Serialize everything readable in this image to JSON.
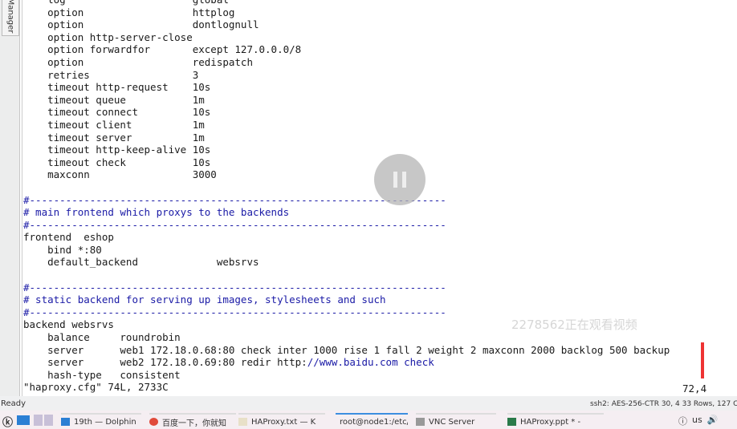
{
  "side_panel": {
    "label": "Manager"
  },
  "editor": {
    "lines": [
      [
        {
          "t": "    log                     global",
          "c": "n"
        }
      ],
      [
        {
          "t": "    option                  httplog",
          "c": "n"
        }
      ],
      [
        {
          "t": "    option                  dontlognull",
          "c": "n"
        }
      ],
      [
        {
          "t": "    option http-server-close",
          "c": "n"
        }
      ],
      [
        {
          "t": "    option forwardfor       except 127.0.0.0/8",
          "c": "n"
        }
      ],
      [
        {
          "t": "    option                  redispatch",
          "c": "n"
        }
      ],
      [
        {
          "t": "    retries                 3",
          "c": "n"
        }
      ],
      [
        {
          "t": "    timeout http-request    10s",
          "c": "n"
        }
      ],
      [
        {
          "t": "    timeout queue           1m",
          "c": "n"
        }
      ],
      [
        {
          "t": "    timeout connect         10s",
          "c": "n"
        }
      ],
      [
        {
          "t": "    timeout client          1m",
          "c": "n"
        }
      ],
      [
        {
          "t": "    timeout server          1m",
          "c": "n"
        }
      ],
      [
        {
          "t": "    timeout http-keep-alive 10s",
          "c": "n"
        }
      ],
      [
        {
          "t": "    timeout check           10s",
          "c": "n"
        }
      ],
      [
        {
          "t": "    maxconn                 3000",
          "c": "n"
        }
      ],
      [
        {
          "t": "",
          "c": "n"
        }
      ],
      [
        {
          "t": "#---------------------------------------------------------------------",
          "c": "c"
        }
      ],
      [
        {
          "t": "# main frontend which proxys to the backends",
          "c": "c"
        }
      ],
      [
        {
          "t": "#---------------------------------------------------------------------",
          "c": "c"
        }
      ],
      [
        {
          "t": "frontend  eshop",
          "c": "n"
        }
      ],
      [
        {
          "t": "    bind *:80",
          "c": "n"
        }
      ],
      [
        {
          "t": "    default_backend             websrvs",
          "c": "n"
        }
      ],
      [
        {
          "t": "",
          "c": "n"
        }
      ],
      [
        {
          "t": "#---------------------------------------------------------------------",
          "c": "c"
        }
      ],
      [
        {
          "t": "# static backend for serving up images, stylesheets and such",
          "c": "c"
        }
      ],
      [
        {
          "t": "#---------------------------------------------------------------------",
          "c": "c"
        }
      ],
      [
        {
          "t": "backend websrvs",
          "c": "n"
        }
      ],
      [
        {
          "t": "    balance     roundrobin",
          "c": "n"
        }
      ],
      [
        {
          "t": "    server      web1 172.18.0.68:80 check inter 1000 rise 1 fall 2 weight 2 maxconn 2000 backlog 500 backup",
          "c": "n"
        }
      ],
      [
        {
          "t": "    server      web2 172.18.0.69:80 redir http:",
          "c": "n"
        },
        {
          "t": "//www.baidu.com check",
          "c": "c"
        }
      ],
      [
        {
          "t": "    hash-type   consistent",
          "c": "n"
        }
      ],
      [
        {
          "t": "\"haproxy.cfg\" 74L, 2733C",
          "c": "n"
        }
      ]
    ],
    "cursor_position": "72,4"
  },
  "overlay": {
    "watermark": "2278562正在观看视频",
    "pause_icon": "pause-icon"
  },
  "status_bar": {
    "left": "Ready",
    "right": "ssh2: AES-256-CTR    30, 4  33 Rows, 127 Co"
  },
  "taskbar": {
    "tasks": [
      {
        "label": "19th — Dolphin",
        "icon": "folder-icon"
      },
      {
        "label": "百度一下，你就知",
        "icon": "chrome-icon"
      },
      {
        "label": "HAProxy.txt — K",
        "icon": "text-file-icon"
      },
      {
        "label": "root@node1:/etc/",
        "icon": "terminal-icon"
      },
      {
        "label": "VNC Server",
        "icon": "vnc-icon"
      },
      {
        "label": "HAProxy.ppt * -",
        "icon": "presentation-icon"
      }
    ],
    "tray_lang": "us"
  },
  "colors": {
    "comment": "#1a1aa6",
    "normal": "#1a1a1a",
    "active_task": "#3d8ee0",
    "marker": "#ee3333"
  }
}
